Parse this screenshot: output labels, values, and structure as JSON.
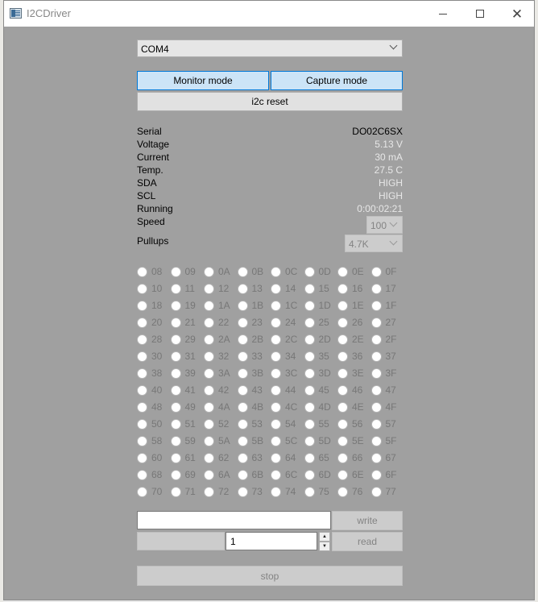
{
  "window": {
    "title": "I2CDriver"
  },
  "port": {
    "selected": "COM4"
  },
  "buttons": {
    "monitor": "Monitor mode",
    "capture": "Capture mode",
    "reset": "i2c reset",
    "write": "write",
    "read": "read",
    "stop": "stop"
  },
  "info": [
    {
      "label": "Serial",
      "value": "DO02C6SX"
    },
    {
      "label": "Voltage",
      "value": "5.13 V"
    },
    {
      "label": "Current",
      "value": "30 mA"
    },
    {
      "label": "Temp.",
      "value": "27.5 C"
    },
    {
      "label": "SDA",
      "value": "HIGH"
    },
    {
      "label": "SCL",
      "value": "HIGH"
    },
    {
      "label": "Running",
      "value": "0:00:02:21"
    }
  ],
  "speed": {
    "label": "Speed",
    "value": "100"
  },
  "pullups": {
    "label": "Pullups",
    "value": "4.7K"
  },
  "addresses": [
    [
      "08",
      "09",
      "0A",
      "0B",
      "0C",
      "0D",
      "0E",
      "0F"
    ],
    [
      "10",
      "11",
      "12",
      "13",
      "14",
      "15",
      "16",
      "17"
    ],
    [
      "18",
      "19",
      "1A",
      "1B",
      "1C",
      "1D",
      "1E",
      "1F"
    ],
    [
      "20",
      "21",
      "22",
      "23",
      "24",
      "25",
      "26",
      "27"
    ],
    [
      "28",
      "29",
      "2A",
      "2B",
      "2C",
      "2D",
      "2E",
      "2F"
    ],
    [
      "30",
      "31",
      "32",
      "33",
      "34",
      "35",
      "36",
      "37"
    ],
    [
      "38",
      "39",
      "3A",
      "3B",
      "3C",
      "3D",
      "3E",
      "3F"
    ],
    [
      "40",
      "41",
      "42",
      "43",
      "44",
      "45",
      "46",
      "47"
    ],
    [
      "48",
      "49",
      "4A",
      "4B",
      "4C",
      "4D",
      "4E",
      "4F"
    ],
    [
      "50",
      "51",
      "52",
      "53",
      "54",
      "55",
      "56",
      "57"
    ],
    [
      "58",
      "59",
      "5A",
      "5B",
      "5C",
      "5D",
      "5E",
      "5F"
    ],
    [
      "60",
      "61",
      "62",
      "63",
      "64",
      "65",
      "66",
      "67"
    ],
    [
      "68",
      "69",
      "6A",
      "6B",
      "6C",
      "6D",
      "6E",
      "6F"
    ],
    [
      "70",
      "71",
      "72",
      "73",
      "74",
      "75",
      "76",
      "77"
    ]
  ],
  "io": {
    "write_value": "",
    "read_count": "1"
  },
  "icons": {
    "app": "app-icon",
    "minimize": "minimize-icon",
    "maximize": "maximize-icon",
    "close": "close-icon",
    "dropdown": "chevron-down-icon"
  }
}
